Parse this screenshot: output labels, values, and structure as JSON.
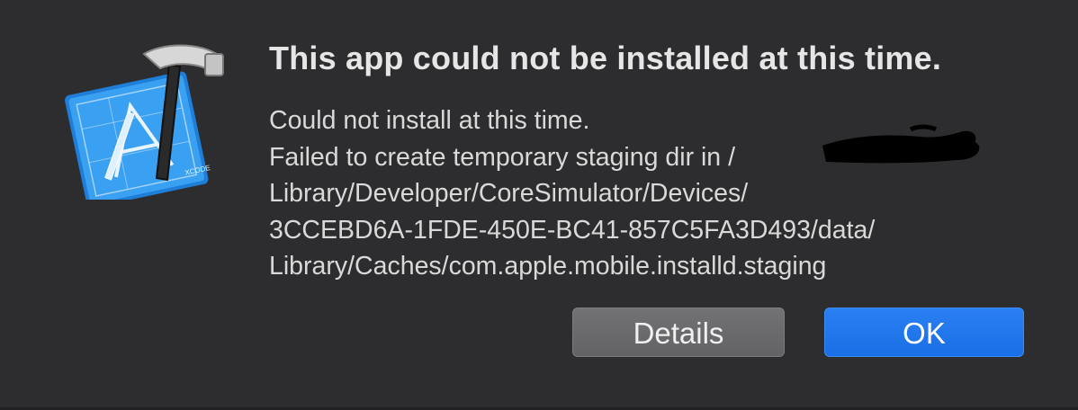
{
  "dialog": {
    "title": "This app could not be installed at this time.",
    "message_lines": [
      "Could not install at this time.",
      "Failed to create temporary staging dir in /",
      "Library/Developer/CoreSimulator/Devices/",
      "3CCEBD6A-1FDE-450E-BC41-857C5FA3D493/data/",
      "Library/Caches/com.apple.mobile.installd.staging"
    ],
    "icon": "xcode-icon",
    "icon_label": "XCODE"
  },
  "buttons": {
    "details_label": "Details",
    "ok_label": "OK"
  },
  "colors": {
    "background": "#2d2d2f",
    "primary_button": "#1a6fe6",
    "secondary_button": "#6a6a6d"
  }
}
